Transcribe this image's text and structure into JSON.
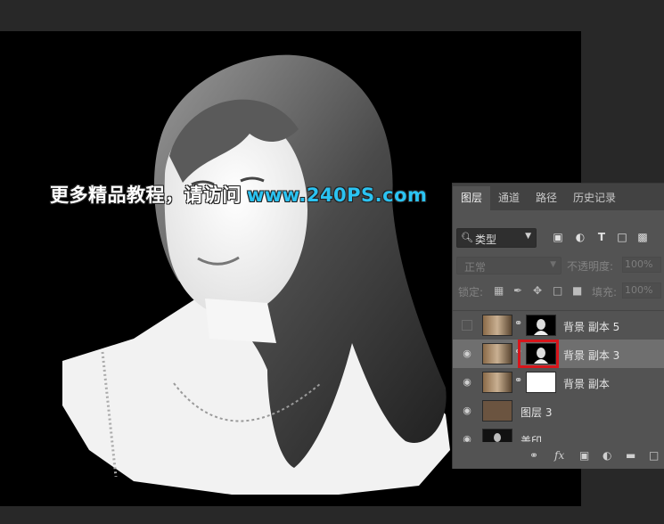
{
  "watermark": {
    "text_cn": "更多精品教程，请访问",
    "url": "www.240PS.com"
  },
  "panel": {
    "tabs": [
      {
        "label": "图层",
        "active": true
      },
      {
        "label": "通道",
        "active": false
      },
      {
        "label": "路径",
        "active": false
      },
      {
        "label": "历史记录",
        "active": false
      }
    ],
    "filter": {
      "label": "类型"
    },
    "blend_mode": "正常",
    "opacity_label": "不透明度:",
    "opacity_value": "100%",
    "lock_label": "锁定:",
    "fill_label": "填充:",
    "fill_value": "100%",
    "layers": [
      {
        "name": "背景 副本 5",
        "visible": false,
        "has_mask": true,
        "mask": "dark",
        "selected": false
      },
      {
        "name": "背景 副本 3",
        "visible": true,
        "has_mask": true,
        "mask": "dark",
        "selected": true
      },
      {
        "name": "背景 副本",
        "visible": true,
        "has_mask": true,
        "mask": "white",
        "selected": false
      },
      {
        "name": "图层 3",
        "visible": true,
        "has_mask": false,
        "fill": "#6b5440",
        "selected": false
      },
      {
        "name": "盖印",
        "visible": true,
        "has_mask": false,
        "selected": false
      }
    ]
  },
  "colors": {
    "accent_url": "#2bc3f2",
    "selection_box": "#d8151b",
    "layer_fill": "#6b5440"
  }
}
